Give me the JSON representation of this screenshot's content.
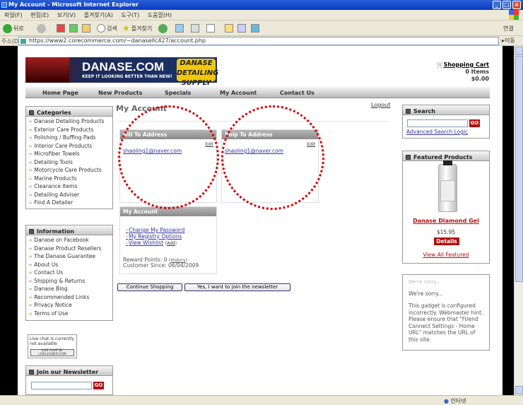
{
  "window": {
    "title": "My Account - Microsoft Internet Explorer"
  },
  "menu": [
    "파일(F)",
    "편집(E)",
    "보기(V)",
    "즐겨찾기(A)",
    "도구(T)",
    "도움말(H)"
  ],
  "toolbar": {
    "back": "뒤로",
    "search": "검색",
    "favorites": "즐겨찾기",
    "links": "연결"
  },
  "address": {
    "label": "주소(D)",
    "url": "https://www2.corecommerce.com/~danasellc427/account.php",
    "go": "이동"
  },
  "status": {
    "zone": "인터넷"
  },
  "banner": {
    "logo": "DANASE.COM",
    "tagline": "KEEP IT LOOKING BETTER THAN NEW!",
    "badge": "DANASE DETAILING SUPPLY"
  },
  "cart": {
    "link": "Shopping Cart",
    "items": "0 Items",
    "total": "$0.00"
  },
  "nav": [
    "Home Page",
    "New Products",
    "Specials",
    "My Account",
    "Contact Us"
  ],
  "categories": {
    "title": "Categories",
    "items": [
      "Danase Detailing Products",
      "Exterior Care Products",
      "Polishing / Buffing Pads",
      "Interior Care Products",
      "Microfiber Towels",
      "Detailing Tools",
      "Motorcycle Care Products",
      "Marine Products",
      "Clearance Items",
      "Detailing Adviser",
      "Find A Detailer"
    ]
  },
  "information": {
    "title": "Information",
    "items": [
      "Danase on Facebook",
      "Danase Product Resellers",
      "The Danase Guarantee",
      "About Us",
      "Contact Us",
      "Shipping & Returns",
      "Danase Blog",
      "Recommended Links",
      "Privacy Notice",
      "Terms of Use"
    ]
  },
  "livechat": {
    "text": "Live chat is currently not available",
    "brand": "LIVE CHAT BY LIVELEADER.COM"
  },
  "newsletter": {
    "title": "Join our Newsletter",
    "go": "GO"
  },
  "main": {
    "title": "My Account",
    "logout": "Logout",
    "bill": {
      "title": "Bill To Address",
      "edit": "Edit",
      "email": "shaoling1@naver.com"
    },
    "ship": {
      "title": "Ship To Address",
      "edit": "Edit",
      "email": "shaoling1@naver.com"
    },
    "account": {
      "title": "My Account",
      "links": [
        "Change My Password",
        "My Registry Options",
        "View Wishlist"
      ],
      "add": "Add",
      "reward_label": "Reward Points: 0",
      "history": "History",
      "since": "Customer Since: 06/04/2009"
    },
    "buttons": {
      "continue": "Continue Shopping",
      "join": "Yes, I want to join the newsletter"
    }
  },
  "search": {
    "title": "Search",
    "go": "GO",
    "advanced": "Advanced Search Logic"
  },
  "featured": {
    "title": "Featured Products",
    "product": "Danase Diamond Gel",
    "price": "$15.95",
    "details": "Details",
    "view_all": "View All Featured"
  },
  "gadget": {
    "faded": "We're sorry...",
    "sorry": "We're sorry...",
    "message": "This gadget is configured incorrectly. Webmaster hint: Please ensure that \"Friend Connect Settings - Home URL\" matches the URL of this site."
  }
}
